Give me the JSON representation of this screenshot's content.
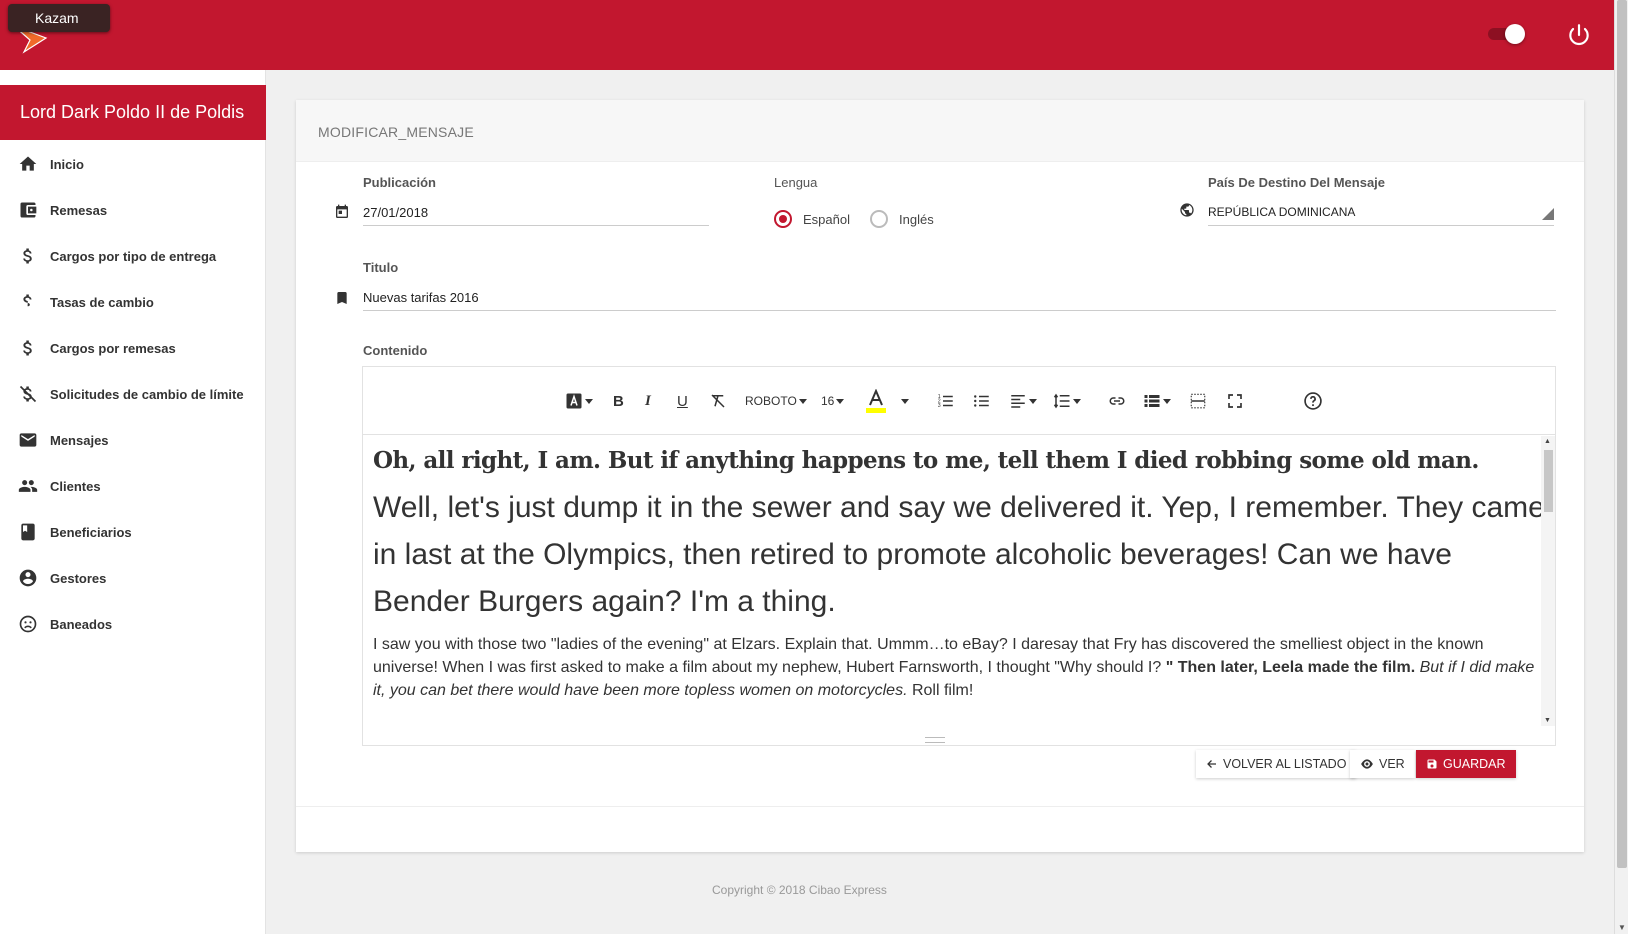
{
  "app": {
    "logo_text": "Kazam",
    "brand_color": "#c2172f"
  },
  "sidebar": {
    "user_name": "Lord Dark Poldo II de Poldis",
    "items": [
      {
        "label": "Inicio",
        "icon": "home-icon"
      },
      {
        "label": "Remesas",
        "icon": "wallet-icon"
      },
      {
        "label": "Cargos por tipo de entrega",
        "icon": "dollar-icon"
      },
      {
        "label": "Tasas de cambio",
        "icon": "dollar-icon"
      },
      {
        "label": "Cargos por remesas",
        "icon": "dollar-icon"
      },
      {
        "label": "Solicitudes de cambio de límite",
        "icon": "dollar-off-icon"
      },
      {
        "label": "Mensajes",
        "icon": "mail-icon"
      },
      {
        "label": "Clientes",
        "icon": "people-icon"
      },
      {
        "label": "Beneficiarios",
        "icon": "book-icon"
      },
      {
        "label": "Gestores",
        "icon": "account-circle-icon"
      },
      {
        "label": "Baneados",
        "icon": "sad-face-icon"
      }
    ]
  },
  "form": {
    "title": "MODIFICAR_MENSAJE",
    "publicacion_label": "Publicación",
    "publicacion_value": "27/01/2018",
    "lengua_label": "Lengua",
    "lengua_options": [
      "Español",
      "Inglés"
    ],
    "lengua_selected": "Español",
    "pais_label": "País De Destino Del Mensaje",
    "pais_value": "REPÚBLICA DOMINICANA",
    "titulo_label": "Titulo",
    "titulo_value": "Nuevas tarifas 2016",
    "contenido_label": "Contenido"
  },
  "editor": {
    "font_name": "ROBOTO",
    "font_size": "16",
    "highlight_color": "#ffff00",
    "content": {
      "heading": "Oh, all right, I am. But if anything happens to me, tell them I died robbing some old man.",
      "large": "Well, let's just dump it in the sewer and say we delivered it. Yep, I remember. They came in last at the Olympics, then retired to promote alcoholic beverages! Can we have Bender Burgers again? I'm a thing.",
      "para_plain": "I saw you with those two \"ladies of the evening\" at Elzars. Explain that. Ummm…to eBay? I daresay that Fry has discovered the smelliest object in the known universe! When I was first asked to make a film about my nephew, Hubert Farnsworth, I thought \"Why should I? ",
      "para_bold": "\" Then later, Leela made the film.",
      "para_italic": " But if I did make it, you can bet there would have been more topless women on motorcycles.",
      "para_end": " Roll film!"
    }
  },
  "actions": {
    "back_label": "VOLVER AL LISTADO",
    "view_label": "VER",
    "save_label": "GUARDAR"
  },
  "footer": {
    "copyright": "Copyright © 2018 Cibao Express"
  }
}
